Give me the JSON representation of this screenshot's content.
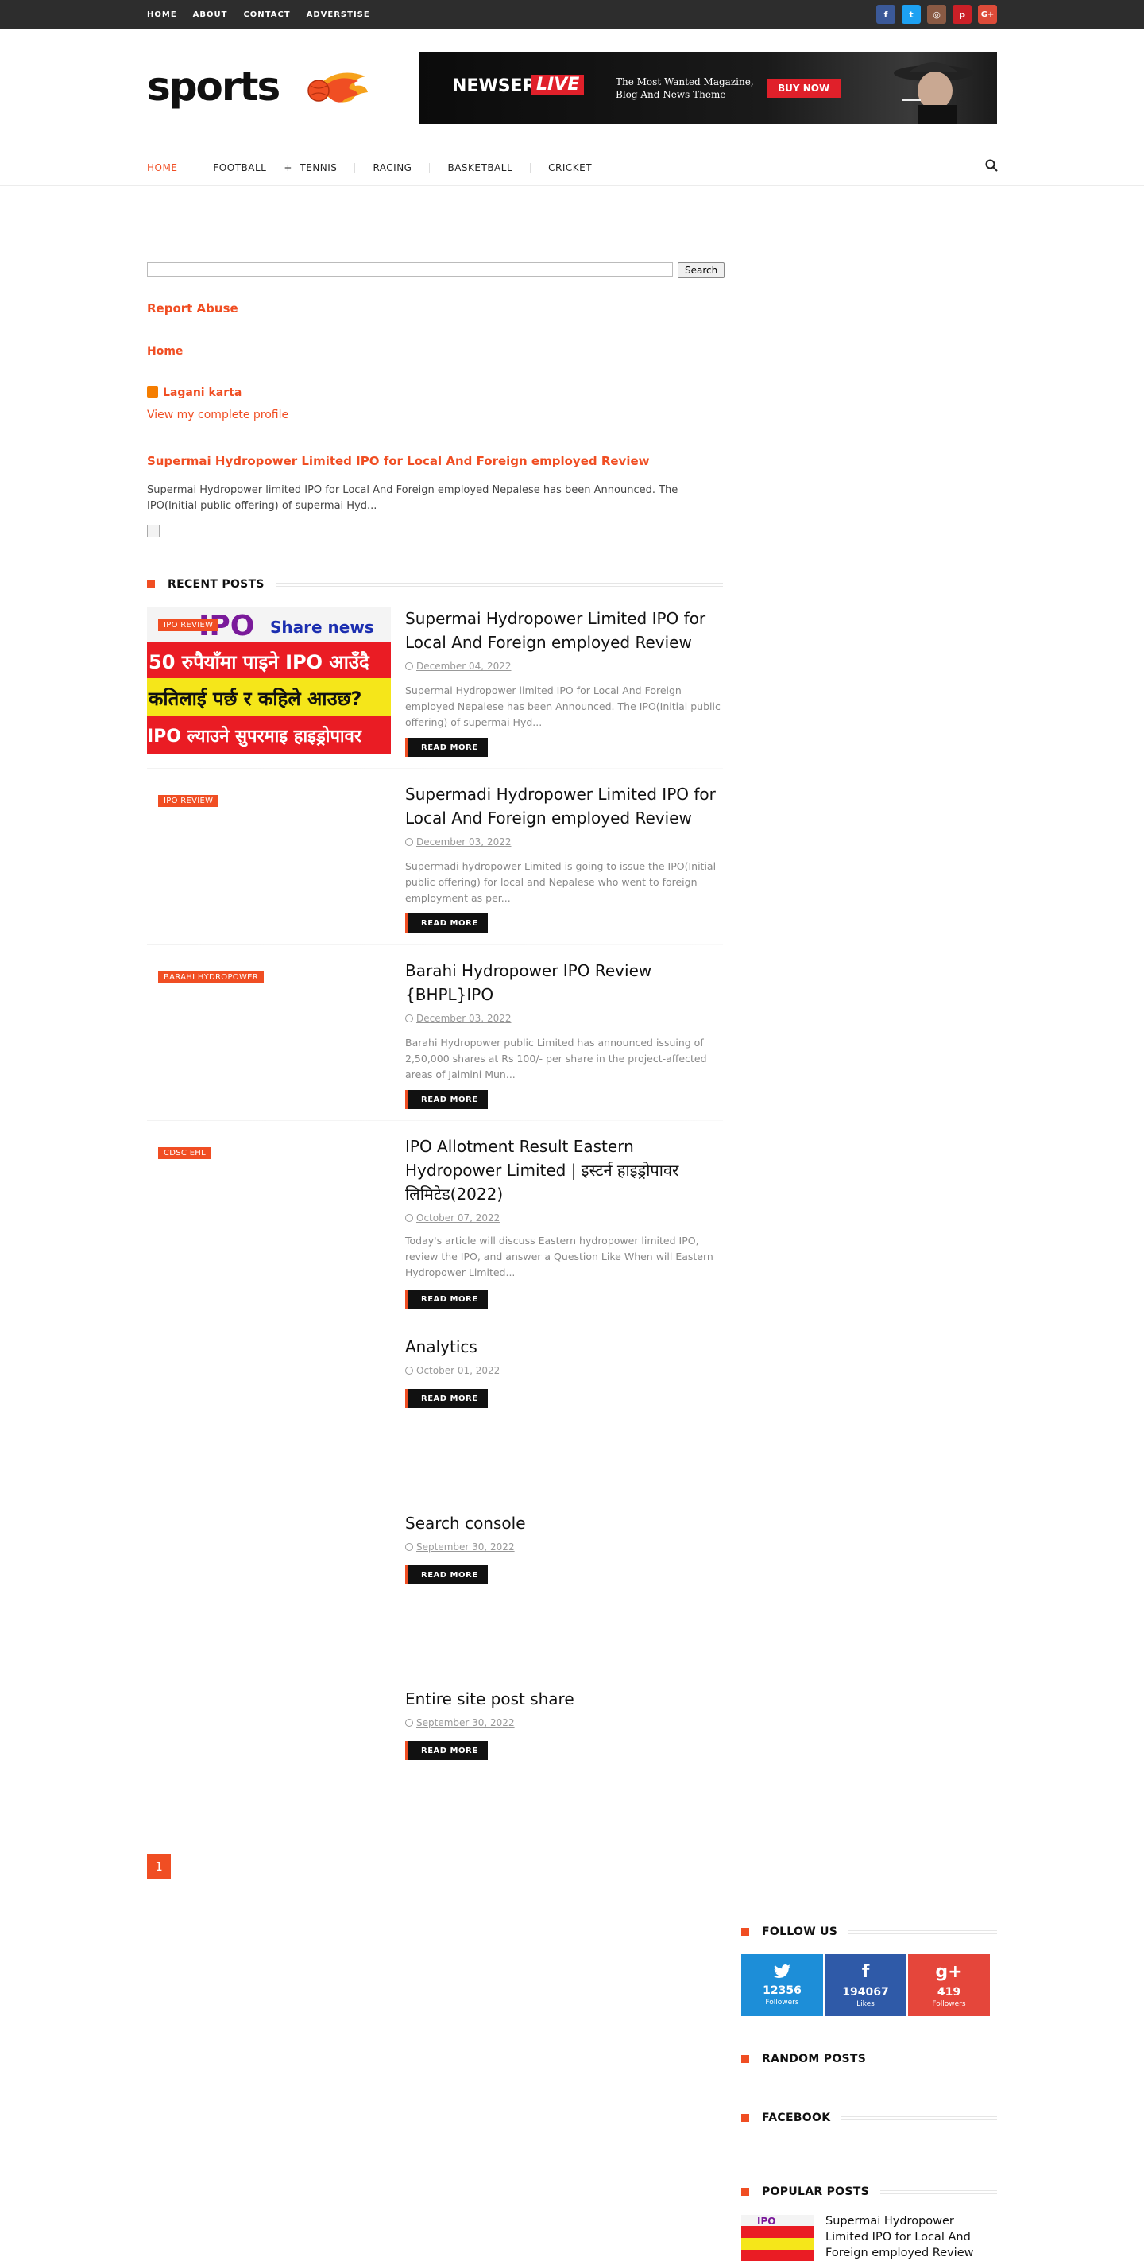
{
  "topbar": {
    "nav": [
      "HOME",
      "ABOUT",
      "CONTACT",
      "ADVERSTISE"
    ],
    "social": [
      {
        "icon": "facebook-icon",
        "glyph": "f",
        "color": "#3b5998"
      },
      {
        "icon": "twitter-icon",
        "glyph": "t",
        "color": "#1da1f2"
      },
      {
        "icon": "instagram-icon",
        "glyph": "◎",
        "color": "#8a5a44"
      },
      {
        "icon": "pinterest-icon",
        "glyph": "p",
        "color": "#cb2027"
      },
      {
        "icon": "google-plus-icon",
        "glyph": "G+",
        "color": "#dd4b39"
      }
    ]
  },
  "header": {
    "logo_text": "sports",
    "banner": {
      "brand": "NEWSER",
      "live": "LIVE",
      "tagline": "The Most Wanted Magazine, Blog And News Theme",
      "button": "BUY NOW"
    }
  },
  "mainnav": {
    "items": [
      "HOME",
      "FOOTBALL",
      "TENNIS",
      "RACING",
      "BASKETBALL",
      "CRICKET"
    ],
    "plus": "+"
  },
  "search": {
    "button": "Search"
  },
  "widgets": {
    "report_abuse": "Report Abuse",
    "home": "Home",
    "profile_name": "Lagani karta",
    "profile_link": "View my complete profile",
    "featured_title": "Supermai Hydropower Limited IPO for Local And Foreign employed Review",
    "featured_snippet": "Supermai Hydropower limited IPO for Local And Foreign employed Nepalese has been Announced. The IPO(Initial public offering) of supermai Hyd..."
  },
  "recent": {
    "heading": "RECENT POSTS",
    "read_more": "READ MORE",
    "posts": [
      {
        "label": "IPO REVIEW",
        "title": "Supermai Hydropower Limited IPO for Local And Foreign employed Review",
        "date": "December 04, 2022",
        "excerpt": "Supermai Hydropower limited IPO for Local And Foreign employed Nepalese has been Announced. The IPO(Initial public offering) of supermai Hyd...",
        "thumb": {
          "line1": "IPO",
          "line1b": "Share news",
          "line2": "50 रुपैयाँमा पाइने IPO आउँदै",
          "line3": "कतिलाई पर्छ र कहिले आउछ?",
          "line4": "IPO ल्याउने सुपरमाइ हाइड्रोपावर"
        }
      },
      {
        "label": "IPO REVIEW",
        "title": "Supermadi Hydropower Limited IPO for Local And Foreign employed Review",
        "date": "December 03, 2022",
        "excerpt": "Supermadi hydropower Limited is going to issue the IPO(Initial public offering) for local and Nepalese who went to foreign employment as per..."
      },
      {
        "label": "BARAHI HYDROPOWER",
        "title": "Barahi Hydropower IPO Review {BHPL}IPO",
        "date": "December 03, 2022",
        "excerpt": "Barahi Hydropower public Limited has announced issuing of 2,50,000 shares at Rs 100/- per share in the project-affected areas of Jaimini Mun..."
      },
      {
        "label": "CDSC EHL",
        "title": "IPO Allotment Result Eastern Hydropower Limited | इस्टर्न हाइड्रोपावर लिमिटेड(2022)",
        "date": "October 07, 2022",
        "excerpt": "Today's article will discuss Eastern hydropower limited IPO, review the IPO, and answer a Question Like When will Eastern Hydropower Limited..."
      },
      {
        "title": "Analytics",
        "date": "October 01, 2022"
      },
      {
        "title": "Search console",
        "date": "September 30, 2022"
      },
      {
        "title": "Entire site post share",
        "date": "September 30, 2022"
      }
    ]
  },
  "pagination": {
    "current": "1"
  },
  "sidebar": {
    "follow_heading": "FOLLOW US",
    "follow": [
      {
        "icon": "twitter-icon",
        "glyph": "🐦",
        "count": "12356",
        "caption": "Followers",
        "color": "#1d8ed8"
      },
      {
        "icon": "facebook-icon",
        "glyph": "f",
        "count": "194067",
        "caption": "Likes",
        "color": "#2f5aa8"
      },
      {
        "icon": "google-plus-icon",
        "glyph": "g+",
        "count": "419",
        "caption": "Followers",
        "color": "#e5463b"
      }
    ],
    "random_heading": "RANDOM POSTS",
    "facebook_heading": "FACEBOOK",
    "popular_heading": "POPULAR POSTS",
    "popular_title": "Supermai Hydropower Limited IPO for Local And Foreign employed Review"
  },
  "colors": {
    "accent": "#f04e23",
    "topbar": "#2d2d2d"
  }
}
